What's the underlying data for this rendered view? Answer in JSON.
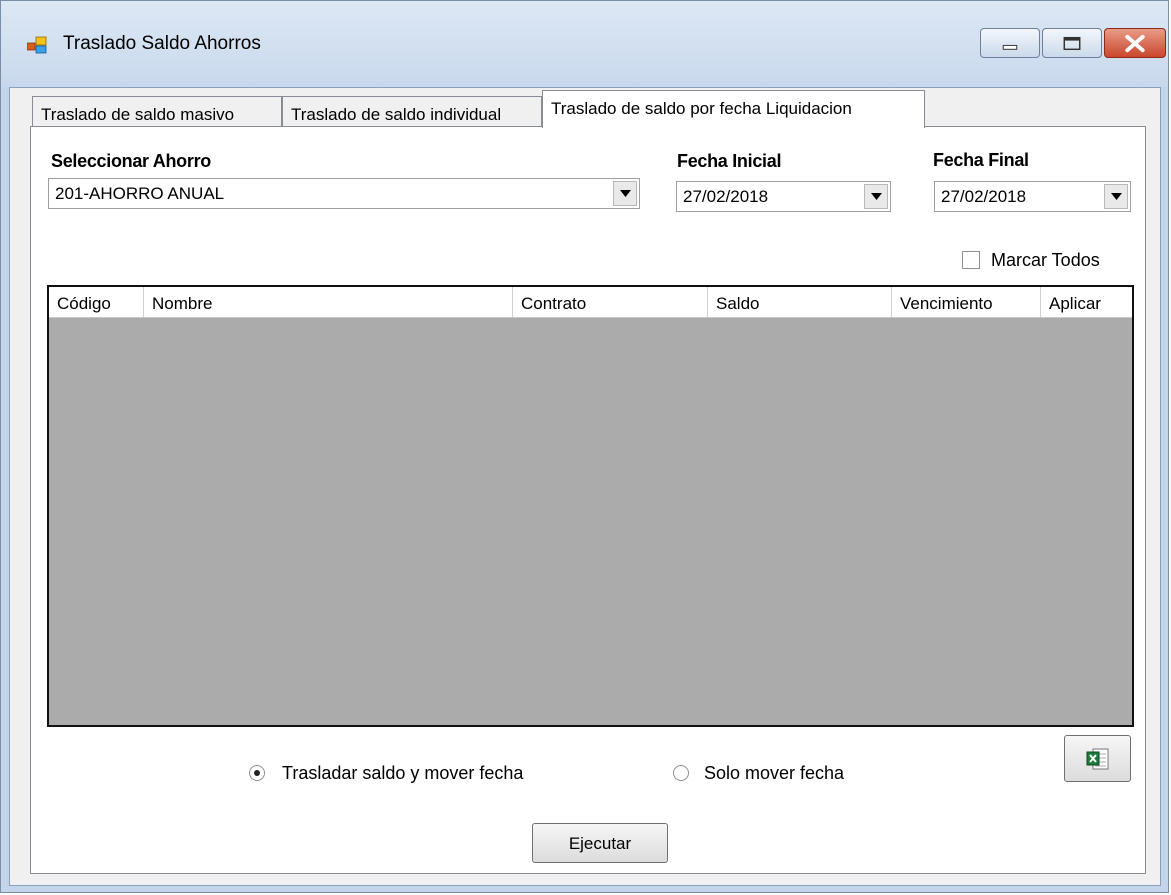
{
  "window": {
    "title": "Traslado Saldo Ahorros"
  },
  "tabs": [
    {
      "label": "Traslado de saldo masivo",
      "selected": false
    },
    {
      "label": "Traslado de saldo individual",
      "selected": false
    },
    {
      "label": "Traslado de saldo por fecha Liquidacion",
      "selected": true
    }
  ],
  "form": {
    "ahorro_label": "Seleccionar Ahorro",
    "ahorro_value": "201-AHORRO ANUAL",
    "fecha_inicial_label": "Fecha Inicial",
    "fecha_inicial_value": "27/02/2018",
    "fecha_final_label": "Fecha Final",
    "fecha_final_value": "27/02/2018",
    "marcar_todos_label": "Marcar Todos",
    "marcar_todos_checked": false
  },
  "grid": {
    "columns": [
      "Código",
      "Nombre",
      "Contrato",
      "Saldo",
      "Vencimiento",
      "Aplicar"
    ],
    "rows": []
  },
  "options": {
    "opt1_label": "Trasladar saldo y mover fecha",
    "opt1_selected": true,
    "opt2_label": "Solo mover fecha",
    "opt2_selected": false
  },
  "actions": {
    "ejecutar_label": "Ejecutar",
    "export_icon": "excel-export-icon"
  },
  "colors": {
    "grid_background": "#ababab",
    "title_bar": "#c8d8ec",
    "close_button": "#c9472e"
  }
}
